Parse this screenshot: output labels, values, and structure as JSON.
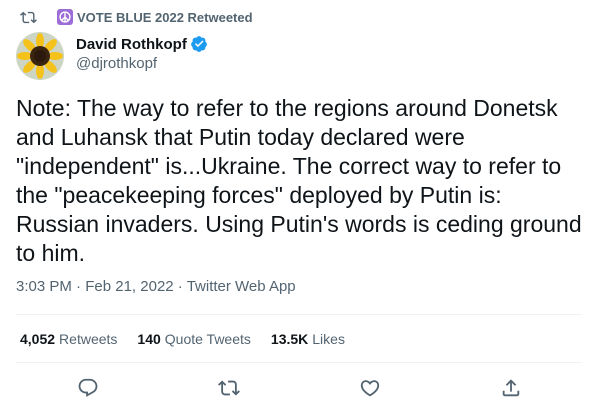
{
  "social_context": {
    "text": "VOTE BLUE 2022 Retweeted"
  },
  "author": {
    "display_name": "David Rothkopf",
    "handle": "@djrothkopf"
  },
  "tweet": {
    "text": "Note: The way to refer to the regions around Donetsk and Luhansk that Putin today declared were \"independent\" is...Ukraine.  The correct way to refer to the \"peacekeeping forces\" deployed by Putin is: Russian invaders.  Using Putin's words is ceding ground to him."
  },
  "meta": {
    "time": "3:03 PM",
    "separator1": " · ",
    "date": "Feb 21, 2022",
    "separator2": " · ",
    "source": "Twitter Web App"
  },
  "stats": {
    "retweets_count": "4,052",
    "retweets_label": "Retweets",
    "quotes_count": "140",
    "quotes_label": "Quote Tweets",
    "likes_count": "13.5K",
    "likes_label": "Likes"
  },
  "actions": {
    "reply_icon": "reply-icon",
    "retweet_icon": "retweet-icon",
    "like_icon": "heart-icon",
    "share_icon": "share-icon"
  },
  "colors": {
    "text": "#0f1419",
    "secondary": "#536471",
    "verified": "#1d9bf0",
    "peace_bg": "#9c6dd6",
    "divider": "#eff3f4"
  }
}
